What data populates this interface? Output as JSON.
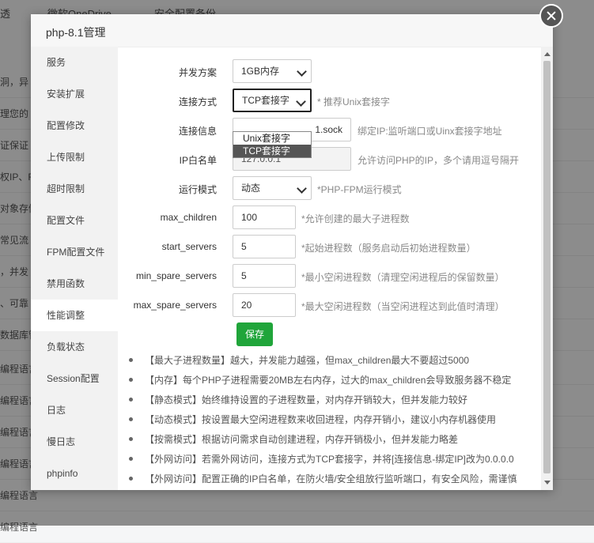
{
  "background": {
    "top_items": [
      "透",
      "微软OneDrive",
      "安全配置备份"
    ],
    "rows": [
      "洞，异",
      "理您的",
      "证保证",
      "权IP、F",
      "对象存储",
      "常见流",
      "，并发",
      "、可靠",
      "数据库管",
      "编程语言",
      "编程语言",
      "编程语言",
      "编程语言",
      "编程语言",
      "编程语言"
    ]
  },
  "modal": {
    "title": "php-8.1管理",
    "sidebar": [
      "服务",
      "安装扩展",
      "配置修改",
      "上传限制",
      "超时限制",
      "配置文件",
      "FPM配置文件",
      "禁用函数",
      "性能调整",
      "负载状态",
      "Session配置",
      "日志",
      "慢日志",
      "phpinfo"
    ],
    "active_index": 8,
    "form": {
      "concurrency": {
        "label": "并发方案",
        "value": "1GB内存"
      },
      "connection": {
        "label": "连接方式",
        "value": "TCP套接字",
        "hint": "* 推荐Unix套接字",
        "options": [
          "Unix套接字",
          "TCP套接字"
        ],
        "selected_option": 1
      },
      "conn_info": {
        "label": "连接信息",
        "value": "1.sock",
        "hint": "绑定IP:监听端口或Uinx套接字地址"
      },
      "ip_whitelist": {
        "label": "IP白名单",
        "value": "127.0.0.1",
        "hint": "允许访问PHP的IP，多个请用逗号隔开"
      },
      "run_mode": {
        "label": "运行模式",
        "value": "动态",
        "hint": "*PHP-FPM运行模式"
      },
      "max_children": {
        "label": "max_children",
        "value": "100",
        "hint": "*允许创建的最大子进程数"
      },
      "start_servers": {
        "label": "start_servers",
        "value": "5",
        "hint": "*起始进程数（服务启动后初始进程数量）"
      },
      "min_spare_servers": {
        "label": "min_spare_servers",
        "value": "5",
        "hint": "*最小空闲进程数（清理空闲进程后的保留数量）"
      },
      "max_spare_servers": {
        "label": "max_spare_servers",
        "value": "20",
        "hint": "*最大空闲进程数（当空闲进程达到此值时清理）"
      }
    },
    "save_label": "保存",
    "tips": [
      "【最大子进程数量】越大，并发能力越强，但max_children最大不要超过5000",
      "【内存】每个PHP子进程需要20MB左右内存，过大的max_children会导致服务器不稳定",
      "【静态模式】始终维持设置的子进程数量，对内存开销较大，但并发能力较好",
      "【动态模式】按设置最大空闲进程数来收回进程，内存开销小，建议小内存机器使用",
      "【按需模式】根据访问需求自动创建进程，内存开销极小，但并发能力略差",
      "【外网访问】若需外网访问，连接方式为TCP套接字，并将[连接信息-绑定IP]改为0.0.0.0",
      "【外网访问】配置正确的IP白名单，在防火墙/安全组放行监听端口，有安全风险，需谨慎"
    ]
  },
  "colors": {
    "accent": "#20a53a",
    "overlay": "rgba(0,0,0,0.45)"
  },
  "icons": [
    "close-icon",
    "chevron-down-icon"
  ]
}
